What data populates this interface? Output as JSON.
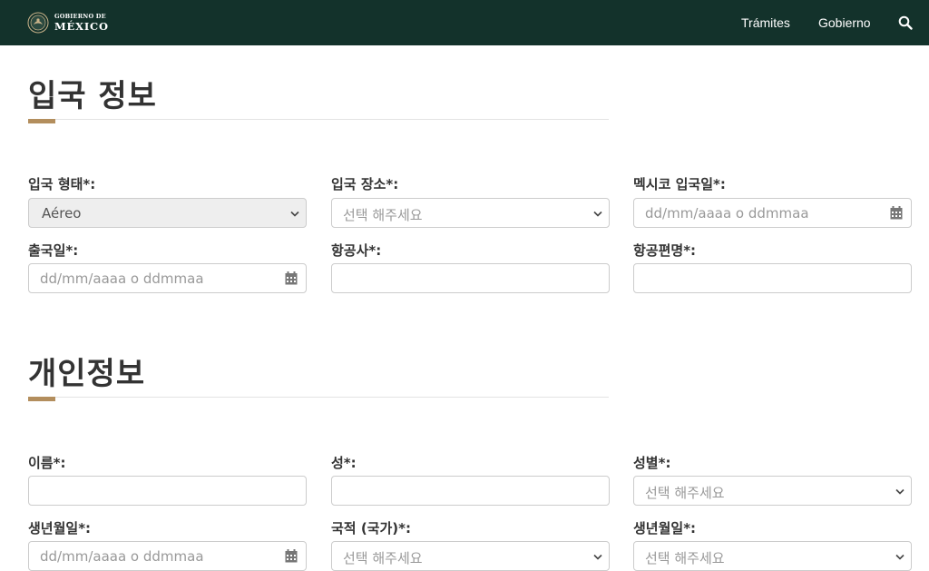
{
  "header": {
    "logo": {
      "line1": "GOBIERNO DE",
      "line2": "MÉXICO"
    },
    "nav": [
      {
        "label": "Trámites"
      },
      {
        "label": "Gobierno"
      }
    ],
    "search_icon": "search-icon"
  },
  "entry_section": {
    "title": "입국 정보",
    "fields": [
      {
        "label": "입국 형태*:",
        "value": "Aéreo",
        "type": "select",
        "disabled": true
      },
      {
        "label": "입국 장소*:",
        "value": "선택 해주세요",
        "type": "select"
      },
      {
        "label": "멕시코 입국일*:",
        "placeholder": "dd/mm/aaaa o ddmmaa",
        "type": "date"
      },
      {
        "label": "출국일*:",
        "placeholder": "dd/mm/aaaa o ddmmaa",
        "type": "date"
      },
      {
        "label": "항공사*:",
        "value": "",
        "type": "text"
      },
      {
        "label": "항공편명*:",
        "value": "",
        "type": "text"
      }
    ]
  },
  "personal_section": {
    "title": "개인정보",
    "fields": [
      {
        "label": "이름*:",
        "value": "",
        "type": "text"
      },
      {
        "label": "성*:",
        "value": "",
        "type": "text"
      },
      {
        "label": "성별*:",
        "value": "선택 해주세요",
        "type": "select"
      },
      {
        "label": "생년월일*:",
        "placeholder": "dd/mm/aaaa o ddmmaa",
        "type": "date"
      },
      {
        "label": "국적 (국가)*:",
        "value": "선택 해주세요",
        "type": "select"
      },
      {
        "label": "생년월일*:",
        "value": "선택 해주세요",
        "type": "select"
      }
    ]
  },
  "colors": {
    "header_bg": "#13322b",
    "accent": "#b38e5d",
    "text": "#333333",
    "placeholder": "#999999"
  }
}
